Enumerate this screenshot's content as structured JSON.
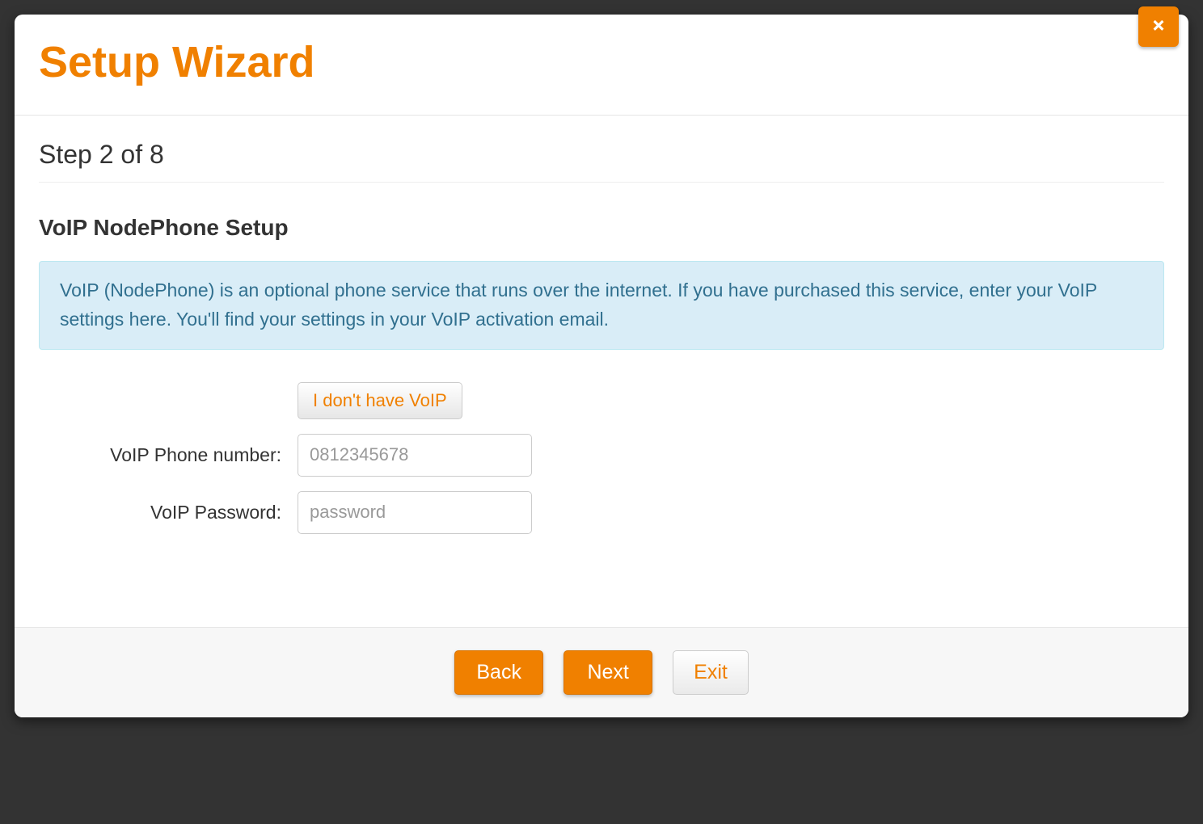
{
  "modal": {
    "title": "Setup Wizard",
    "step_label": "Step 2 of 8",
    "section_heading": "VoIP NodePhone Setup",
    "info_text": "VoIP (NodePhone) is an optional phone service that runs over the internet. If you have purchased this service, enter your VoIP settings here. You'll find your settings in your VoIP activation email.",
    "no_voip_button": "I don't have VoIP",
    "phone_label": "VoIP Phone number:",
    "phone_placeholder": "0812345678",
    "password_label": "VoIP Password:",
    "password_placeholder": "password"
  },
  "footer": {
    "back": "Back",
    "next": "Next",
    "exit": "Exit"
  }
}
